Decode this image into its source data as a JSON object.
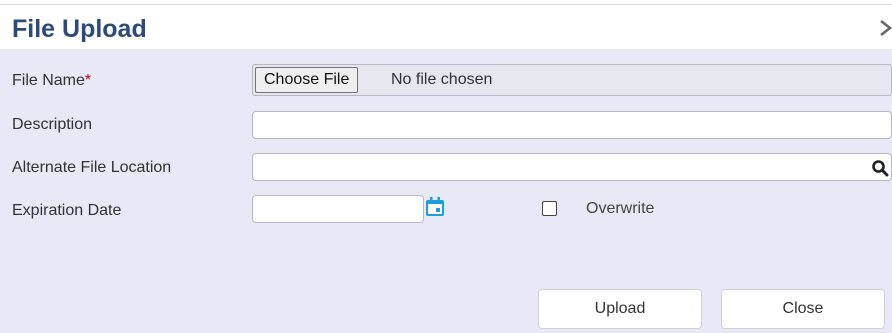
{
  "dialog": {
    "title": "File Upload",
    "close_icon": "close-x-icon"
  },
  "fields": {
    "file_name": {
      "label": "File Name",
      "required_mark": "*",
      "choose_label": "Choose File",
      "status": "No file chosen"
    },
    "description": {
      "label": "Description",
      "value": ""
    },
    "alternate_location": {
      "label": "Alternate File Location",
      "value": "",
      "icon": "search-icon"
    },
    "expiration_date": {
      "label": "Expiration Date",
      "value": "",
      "icon": "calendar-icon"
    },
    "overwrite": {
      "label": "Overwrite",
      "checked": false
    }
  },
  "buttons": {
    "upload": "Upload",
    "close": "Close"
  },
  "colors": {
    "title": "#2c4a7a",
    "body_bg": "#e8e8f6",
    "required": "#cc0000",
    "calendar_icon": "#1e9fd8"
  }
}
